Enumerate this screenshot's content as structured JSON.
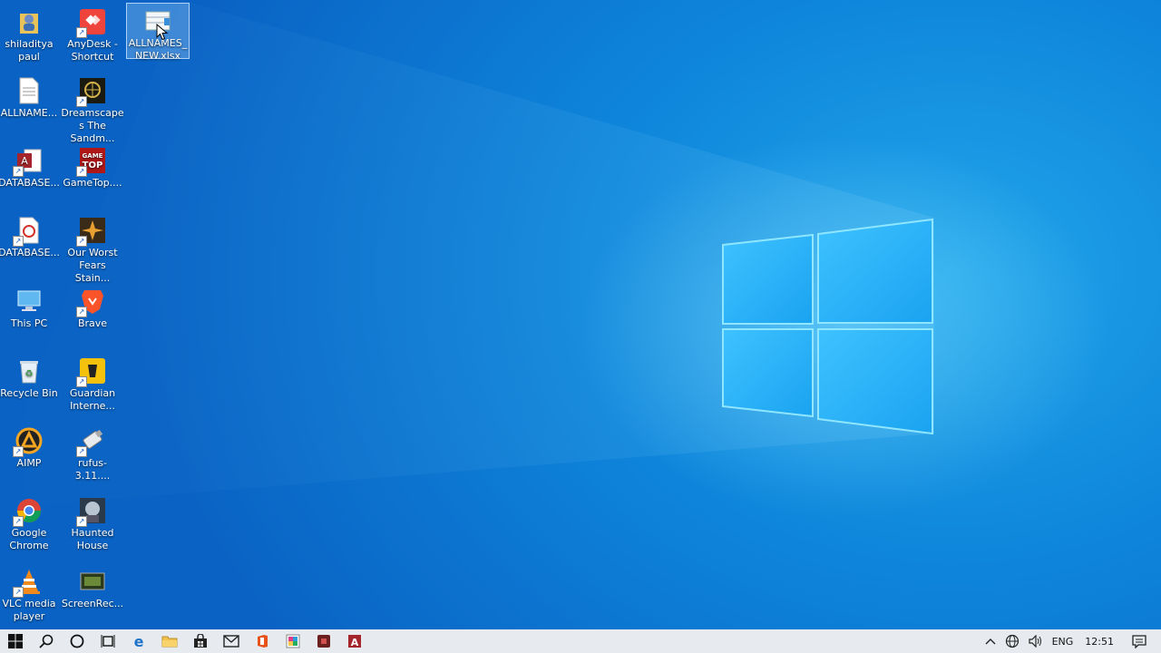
{
  "desktop": {
    "icons": [
      {
        "label": "shiladitya paul"
      },
      {
        "label": "AnyDesk - Shortcut"
      },
      {
        "label": "ALLNAMES_ NEW.xlsx"
      },
      {
        "label": "ALLNAME..."
      },
      {
        "label": "Dreamscapes The Sandm..."
      },
      {
        "label": "DATABASE..."
      },
      {
        "label": "GameTop...."
      },
      {
        "label": "DATABASE..."
      },
      {
        "label": "Our Worst Fears Stain..."
      },
      {
        "label": "This PC"
      },
      {
        "label": "Brave"
      },
      {
        "label": "Recycle Bin"
      },
      {
        "label": "Guardian Interne..."
      },
      {
        "label": "AIMP"
      },
      {
        "label": "rufus-3.11...."
      },
      {
        "label": "Google Chrome"
      },
      {
        "label": "Haunted House"
      },
      {
        "label": "VLC media player"
      },
      {
        "label": "ScreenRec..."
      }
    ]
  },
  "taskbar": {
    "buttons": [
      "start-icon",
      "search-icon",
      "cortana-icon",
      "task-view-icon",
      "edge-icon",
      "file-explorer-icon",
      "store-icon",
      "mail-icon",
      "office-icon",
      "photos-icon",
      "app-icon",
      "access-icon"
    ],
    "tray": {
      "language": "ENG",
      "time": "12:51"
    }
  },
  "colors": {
    "desktop_blue": "#0e86db",
    "taskbar": "#e7ebf0"
  }
}
